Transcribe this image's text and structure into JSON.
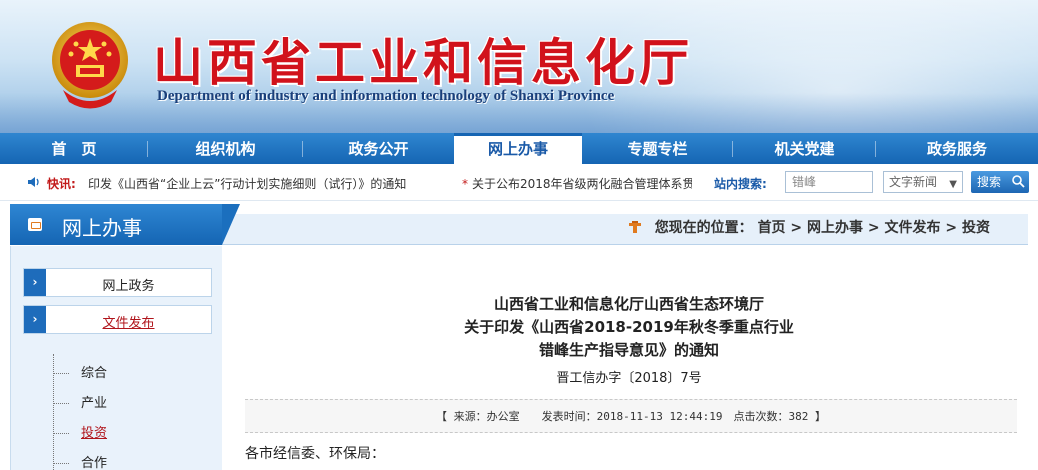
{
  "header": {
    "title_cn": "山西省工业和信息化厅",
    "title_en": "Department of industry and information technology of Shanxi Province"
  },
  "nav": {
    "items": [
      {
        "label": "首　页"
      },
      {
        "label": "组织机构"
      },
      {
        "label": "政务公开"
      },
      {
        "label": "网上办事"
      },
      {
        "label": "专题专栏"
      },
      {
        "label": "机关党建"
      },
      {
        "label": "政务服务"
      }
    ],
    "active": "网上办事"
  },
  "notice": {
    "label": "快讯:",
    "item1": "印发《山西省“企业上云”行动计划实施细则（试行）》的通知",
    "item2": "关于公布2018年省级两化融合管理体系贯",
    "search_label": "站内搜索:",
    "search_value": "错峰",
    "select_value": "文字新闻",
    "search_button": "搜索"
  },
  "section": {
    "title": "网上办事",
    "breadcrumb_prefix": "您现在的位置：",
    "breadcrumb": "首页 > 网上办事 > 文件发布 > 投资"
  },
  "sidebar": {
    "buttons": [
      {
        "label": "网上政务"
      },
      {
        "label": "文件发布"
      }
    ],
    "tree": [
      {
        "label": "综合"
      },
      {
        "label": "产业"
      },
      {
        "label": "投资"
      },
      {
        "label": "合作"
      }
    ],
    "current_tree_item": "投资"
  },
  "article": {
    "title_lines": [
      "山西省工业和信息化厅山西省生态环境厅",
      "关于印发《山西省2018-2019年秋冬季重点行业",
      "错峰生产指导意见》的通知"
    ],
    "doc_number": "晋工信办字〔2018〕7号",
    "meta": "【 来源：办公室　　发表时间：2018-11-13 12:44:19　点击次数：382 】",
    "salutation": "各市经信委、环保局："
  },
  "colors": {
    "brand_red": "#d1121b",
    "nav_blue": "#1565b3",
    "link_red": "#b0141b"
  }
}
